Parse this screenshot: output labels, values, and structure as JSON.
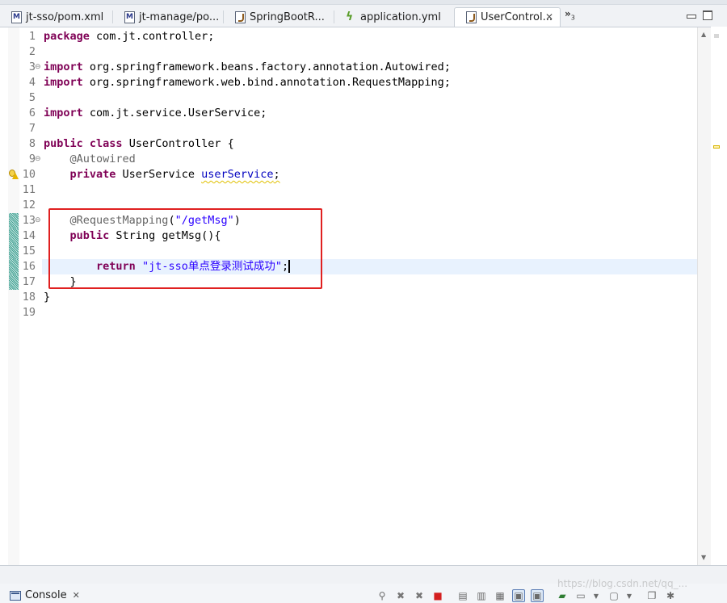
{
  "tabs": [
    {
      "label": "jt-sso/pom.xml",
      "icon": "maven-pom-icon",
      "active": false
    },
    {
      "label": "jt-manage/po...",
      "icon": "maven-pom-icon",
      "active": false
    },
    {
      "label": "SpringBootR...",
      "icon": "java-file-icon",
      "active": false
    },
    {
      "label": "application.yml",
      "icon": "yaml-file-icon",
      "active": false
    },
    {
      "label": "UserControl...",
      "icon": "java-file-icon",
      "active": true,
      "close": "✕"
    }
  ],
  "overflow": {
    "label": "»",
    "count": "3"
  },
  "editor": {
    "line_numbers": [
      "1",
      "2",
      "3",
      "4",
      "5",
      "6",
      "7",
      "8",
      "9",
      "10",
      "11",
      "12",
      "13",
      "14",
      "15",
      "16",
      "17",
      "18",
      "19"
    ],
    "lines": {
      "l1_kw": "package",
      "l1_rest": " com.jt.controller;",
      "l3_kw": "import",
      "l3_rest": " org.springframework.beans.factory.annotation.Autowired;",
      "l4_kw": "import",
      "l4_rest": " org.springframework.web.bind.annotation.RequestMapping;",
      "l6_kw": "import",
      "l6_rest": " com.jt.service.UserService;",
      "l8_kw1": "public",
      "l8_kw2": "class",
      "l8_rest": " UserController {",
      "l9_ann": "@Autowired",
      "l10_kw": "private",
      "l10_type": " UserService ",
      "l10_field": "userService",
      "l10_end": ";",
      "l13_ann": "@RequestMapping",
      "l13_open": "(",
      "l13_str": "\"/getMsg\"",
      "l13_close": ")",
      "l14_kw": "public",
      "l14_rest": " String getMsg(){",
      "l16_kw": "return",
      "l16_str": "\"jt-sso单点登录测试成功\"",
      "l16_end": ";",
      "l17": "}",
      "l18": "}"
    }
  },
  "console": {
    "label": "Console",
    "close": "✕"
  },
  "watermark": "https://blog.csdn.net/qq_..."
}
